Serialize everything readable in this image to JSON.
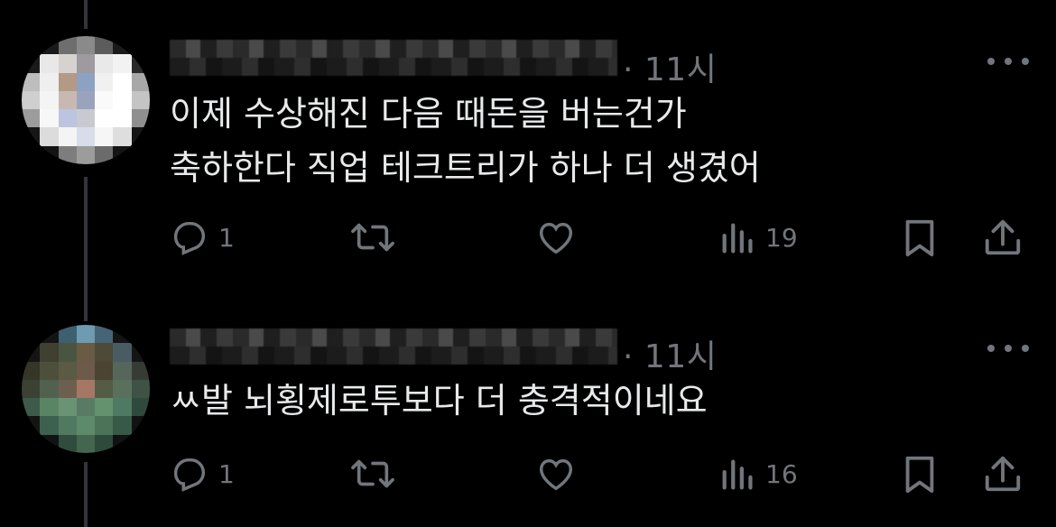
{
  "tweets": [
    {
      "time": "· 11시",
      "lines": [
        "이제 수상해진 다음 때돈을 버는건가",
        "축하한다 직업 테크트리가 하나 더 생겼어"
      ],
      "replies": "1",
      "views": "19"
    },
    {
      "time": "· 11시",
      "lines": [
        "ㅆ발 뇌횡제로투보다 더 충격적이네요"
      ],
      "replies": "1",
      "views": "16"
    }
  ],
  "icons": [
    "reply-icon",
    "retweet-icon",
    "like-icon",
    "views-icon",
    "bookmark-icon",
    "share-icon",
    "more-icon"
  ],
  "colors": {
    "background": "#000000",
    "text": "#e7e9ea",
    "muted": "#71767b",
    "thread_line": "#333639"
  }
}
